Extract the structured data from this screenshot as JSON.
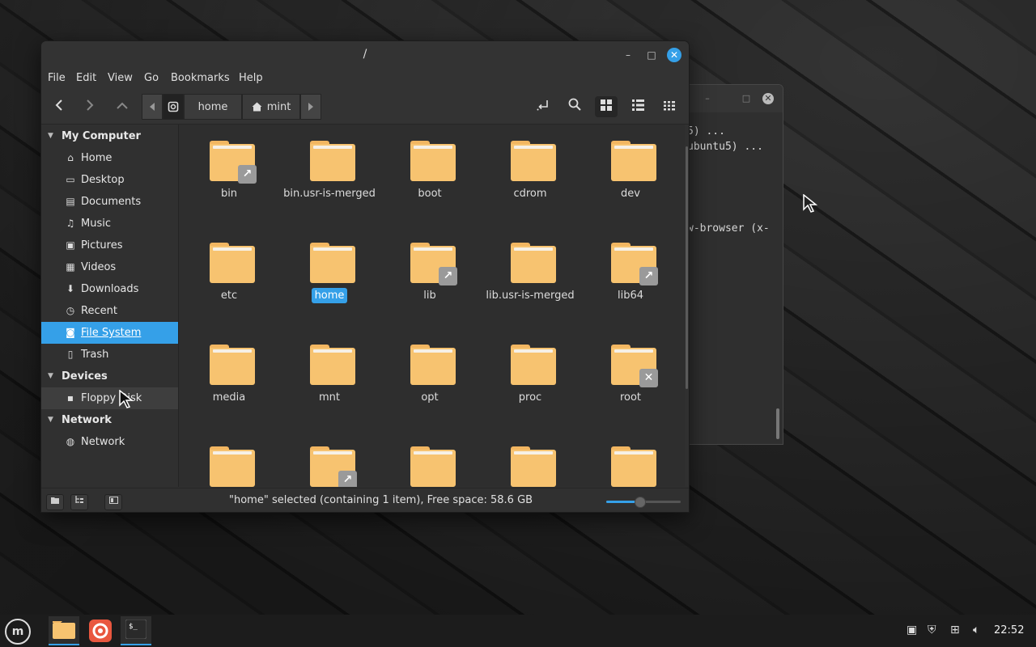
{
  "window": {
    "title": "/",
    "controls": {
      "minimize": "–",
      "maximize": "□",
      "close": "✕"
    }
  },
  "menubar": [
    "File",
    "Edit",
    "View",
    "Go",
    "Bookmarks",
    "Help"
  ],
  "pathbar": [
    "home",
    "mint"
  ],
  "sidebar": {
    "sections": [
      {
        "label": "My Computer",
        "items": [
          {
            "label": "Home",
            "icon": "home-icon"
          },
          {
            "label": "Desktop",
            "icon": "desktop-icon"
          },
          {
            "label": "Documents",
            "icon": "document-icon"
          },
          {
            "label": "Music",
            "icon": "music-icon"
          },
          {
            "label": "Pictures",
            "icon": "pictures-icon"
          },
          {
            "label": "Videos",
            "icon": "video-icon"
          },
          {
            "label": "Downloads",
            "icon": "download-icon"
          },
          {
            "label": "Recent",
            "icon": "recent-icon"
          },
          {
            "label": "File System",
            "icon": "drive-icon"
          },
          {
            "label": "Trash",
            "icon": "trash-icon"
          }
        ]
      },
      {
        "label": "Devices",
        "items": [
          {
            "label": "Floppy Disk",
            "icon": "floppy-icon"
          }
        ]
      },
      {
        "label": "Network",
        "items": [
          {
            "label": "Network",
            "icon": "network-globe-icon"
          }
        ]
      }
    ],
    "selected": "File System"
  },
  "files": [
    {
      "name": "bin",
      "emblem": "symlink"
    },
    {
      "name": "bin.usr-is-merged",
      "emblem": ""
    },
    {
      "name": "boot",
      "emblem": ""
    },
    {
      "name": "cdrom",
      "emblem": ""
    },
    {
      "name": "dev",
      "emblem": ""
    },
    {
      "name": "etc",
      "emblem": ""
    },
    {
      "name": "home",
      "emblem": "",
      "selected": true
    },
    {
      "name": "lib",
      "emblem": "symlink"
    },
    {
      "name": "lib.usr-is-merged",
      "emblem": ""
    },
    {
      "name": "lib64",
      "emblem": "symlink"
    },
    {
      "name": "media",
      "emblem": ""
    },
    {
      "name": "mnt",
      "emblem": ""
    },
    {
      "name": "opt",
      "emblem": ""
    },
    {
      "name": "proc",
      "emblem": ""
    },
    {
      "name": "root",
      "emblem": "locked"
    },
    {
      "name": "",
      "emblem": ""
    },
    {
      "name": "",
      "emblem": "symlink"
    },
    {
      "name": "",
      "emblem": ""
    },
    {
      "name": "",
      "emblem": ""
    },
    {
      "name": "",
      "emblem": ""
    }
  ],
  "status": {
    "text": "\"home\" selected (containing 1 item), Free space: 58.6 GB",
    "zoom_fraction": 0.45
  },
  "terminal": {
    "lines": [
      "5) ...",
      "ubuntu5) ...",
      "w-browser (x-"
    ]
  },
  "taskbar": {
    "clock": "22:52",
    "apps": [
      "file-manager",
      "firefox",
      "terminal"
    ]
  },
  "colors": {
    "accent": "#35a0e8",
    "folder": "#f7c370"
  }
}
